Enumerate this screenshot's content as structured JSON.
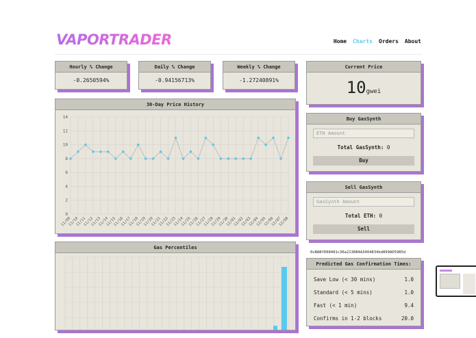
{
  "brand": {
    "logo": "VAPORTRADER"
  },
  "nav": {
    "items": [
      "Home",
      "Charts",
      "Orders",
      "About"
    ],
    "active": "Charts"
  },
  "stats": [
    {
      "label": "Hourly % Change",
      "value": "-0.2650594%"
    },
    {
      "label": "Daily % Change",
      "value": "-0.94156713%"
    },
    {
      "label": "Weekly % Change",
      "value": "-1.27240891%"
    }
  ],
  "current_price": {
    "title": "Current Price",
    "value": "10",
    "unit": "gwei"
  },
  "buy": {
    "title": "Buy GasSynth",
    "placeholder": "ETH Amount",
    "total_label": "Total GasSynth:",
    "total_value": "0",
    "button": "Buy"
  },
  "sell": {
    "title": "Sell GasSynth",
    "placeholder": "GasSynth Amount",
    "total_label": "Total ETH:",
    "total_value": "0",
    "button": "Sell"
  },
  "address": "0xBABfD08481c36a2136B4A3404834bd899AD5985d",
  "history": {
    "title": "30-Day Price History"
  },
  "percentiles": {
    "title": "Gas Percentiles"
  },
  "confirm": {
    "title": "Predicted Gas Confirmation Times:",
    "rows": [
      {
        "label": "Save Low (< 30 mins)",
        "value": "1.0"
      },
      {
        "label": "Standard (< 5 mins)",
        "value": "1.0"
      },
      {
        "label": "Fast (< 1 min)",
        "value": "9.4"
      },
      {
        "label": "Confirms in 1-2 blocks",
        "value": "20.0"
      }
    ]
  },
  "chart_data": [
    {
      "type": "line",
      "title": "30-Day Price History",
      "x": [
        "11/09",
        "11/10",
        "11/11",
        "11/12",
        "11/13",
        "11/14",
        "11/15",
        "11/16",
        "11/17",
        "11/18",
        "11/19",
        "11/20",
        "11/21",
        "11/22",
        "11/23",
        "11/24",
        "11/25",
        "11/26",
        "11/27",
        "11/28",
        "11/29",
        "11/30",
        "12/01",
        "12/02",
        "12/03",
        "12/04",
        "12/05",
        "12/06",
        "12/07",
        "12/08"
      ],
      "values": [
        8,
        9,
        10,
        9,
        9,
        9,
        8,
        9,
        8,
        10,
        8,
        8,
        9,
        8,
        11,
        8,
        9,
        8,
        11,
        10,
        8,
        8,
        8,
        8,
        8,
        11,
        10,
        11,
        8,
        11
      ],
      "ylim": [
        0,
        14
      ],
      "yticks": [
        0,
        2,
        4,
        6,
        8,
        10,
        12,
        14
      ],
      "grid": true,
      "color": "#5bc8f0"
    },
    {
      "type": "bar",
      "title": "Gas Percentiles",
      "categories": [],
      "values": [],
      "grid": true,
      "color": "#5bc8f0"
    }
  ],
  "colors": {
    "accent": "#a974d3",
    "chart": "#5bc8f0",
    "panel": "#e8e6dc",
    "header": "#c9c7bd"
  }
}
